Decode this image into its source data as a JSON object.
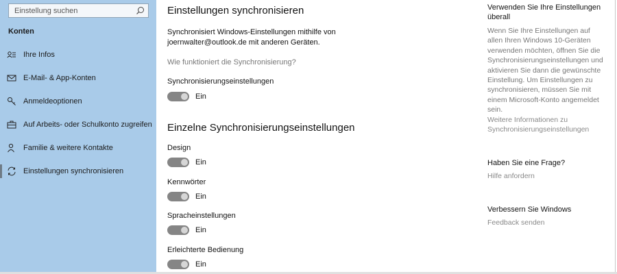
{
  "search": {
    "placeholder": "Einstellung suchen"
  },
  "sidebar": {
    "group_title": "Konten",
    "items": [
      {
        "label": "Ihre Infos",
        "icon": "person-card-icon"
      },
      {
        "label": "E-Mail- & App-Konten",
        "icon": "mail-icon"
      },
      {
        "label": "Anmeldeoptionen",
        "icon": "key-icon"
      },
      {
        "label": "Auf Arbeits- oder Schulkonto zugreifen",
        "icon": "briefcase-icon"
      },
      {
        "label": "Familie & weitere Kontakte",
        "icon": "people-icon"
      },
      {
        "label": "Einstellungen synchronisieren",
        "icon": "sync-icon",
        "active": true
      }
    ]
  },
  "main": {
    "title": "Einstellungen synchronisieren",
    "description": "Synchronisiert Windows-Einstellungen mithilfe von joernwalter@outlook.de mit anderen Geräten.",
    "how_link": "Wie funktioniert die Synchronisierung?",
    "sync_settings": {
      "label": "Synchronisierungseinstellungen",
      "state": "Ein"
    },
    "section_title": "Einzelne Synchronisierungseinstellungen",
    "items": [
      {
        "label": "Design",
        "state": "Ein"
      },
      {
        "label": "Kennwörter",
        "state": "Ein"
      },
      {
        "label": "Spracheinstellungen",
        "state": "Ein"
      },
      {
        "label": "Erleichterte Bedienung",
        "state": "Ein"
      }
    ]
  },
  "aside": {
    "use_settings_title": "Verwenden Sie Ihre Einstellungen überall",
    "use_settings_text": "Wenn Sie Ihre Einstellungen auf allen Ihren Windows 10-Geräten verwenden möchten, öffnen Sie die Synchronisierungseinstellungen und aktivieren Sie dann die gewünschte Einstellung. Um Einstellungen zu synchronisieren, müssen Sie mit einem Microsoft-Konto angemeldet sein.",
    "more_info_link": "Weitere Informationen zu Synchronisierungseinstellungen",
    "question_title": "Haben Sie eine Frage?",
    "help_link": "Hilfe anfordern",
    "improve_title": "Verbessern Sie Windows",
    "feedback_link": "Feedback senden"
  },
  "colors": {
    "sidebar_bg": "#a9cbe9",
    "toggle_on": "#858585",
    "link_gray": "#777777"
  }
}
